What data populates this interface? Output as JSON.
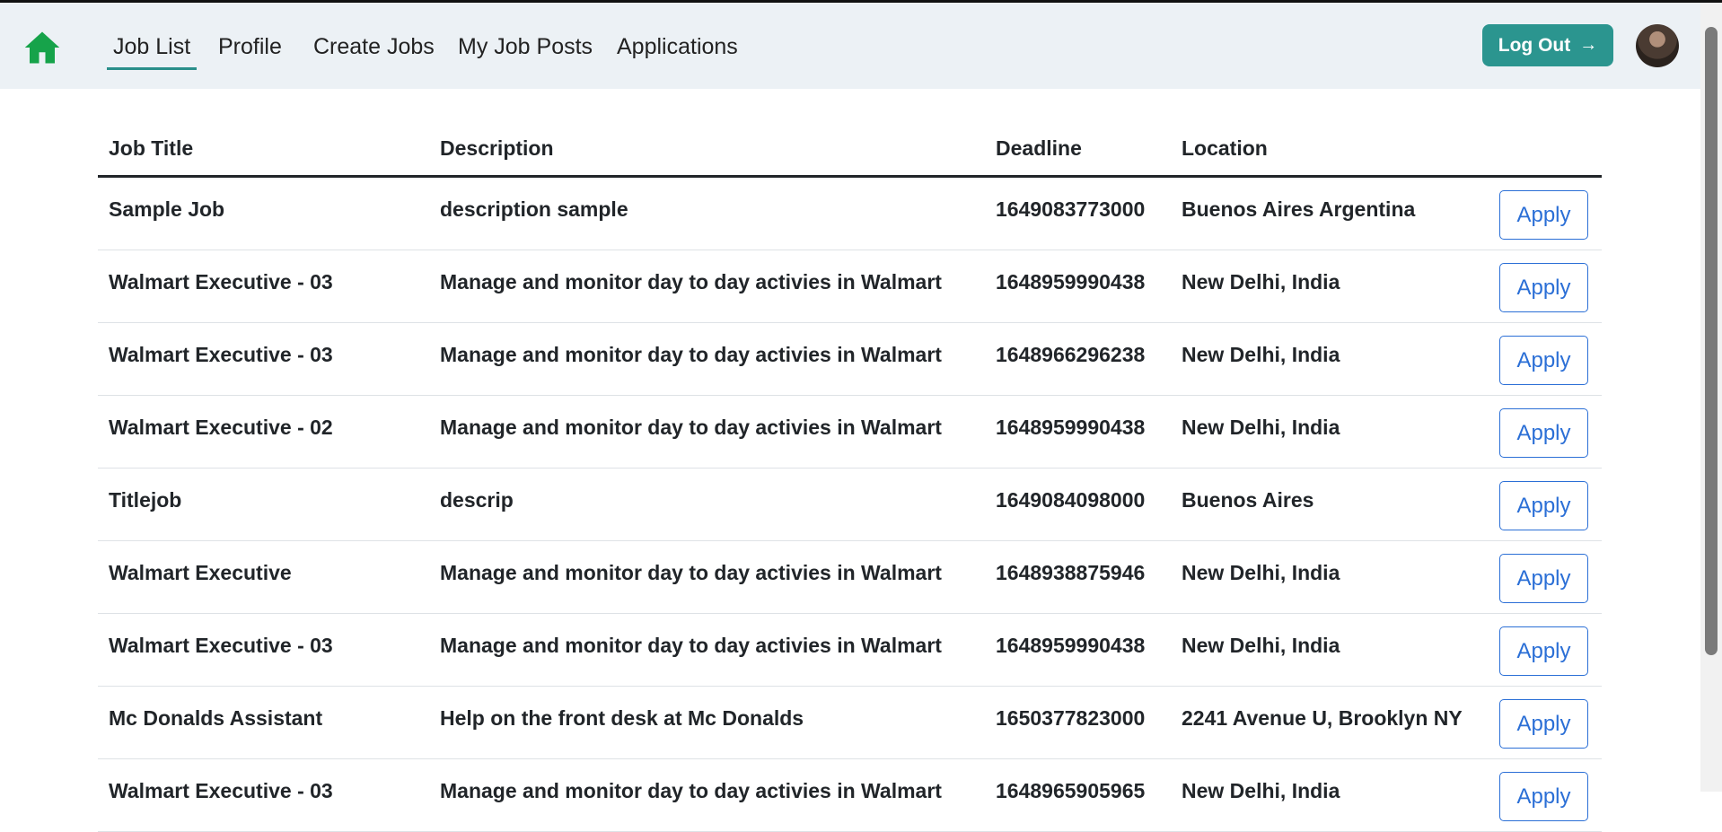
{
  "nav": {
    "items": [
      {
        "label": "Job List",
        "active": true
      },
      {
        "label": "Profile",
        "active": false
      },
      {
        "label": "Create Jobs",
        "active": false
      },
      {
        "label": "My Job Posts",
        "active": false
      },
      {
        "label": "Applications",
        "active": false
      }
    ],
    "logout_label": "Log Out",
    "home_icon": "home-icon",
    "logout_icon": "arrow-right-icon",
    "accent_color": "#2b958f",
    "home_icon_color": "#16a34a"
  },
  "table": {
    "headers": {
      "title": "Job Title",
      "description": "Description",
      "deadline": "Deadline",
      "location": "Location"
    },
    "apply_label": "Apply",
    "rows": [
      {
        "title": "Sample Job",
        "description": "description sample",
        "deadline": "1649083773000",
        "location": "Buenos Aires Argentina"
      },
      {
        "title": "Walmart Executive - 03",
        "description": "Manage and monitor day to day activies in Walmart",
        "deadline": "1648959990438",
        "location": "New Delhi, India"
      },
      {
        "title": "Walmart Executive - 03",
        "description": "Manage and monitor day to day activies in Walmart",
        "deadline": "1648966296238",
        "location": "New Delhi, India"
      },
      {
        "title": "Walmart Executive - 02",
        "description": "Manage and monitor day to day activies in Walmart",
        "deadline": "1648959990438",
        "location": "New Delhi, India"
      },
      {
        "title": "Titlejob",
        "description": "descrip",
        "deadline": "1649084098000",
        "location": "Buenos Aires"
      },
      {
        "title": "Walmart Executive",
        "description": "Manage and monitor day to day activies in Walmart",
        "deadline": "1648938875946",
        "location": "New Delhi, India"
      },
      {
        "title": "Walmart Executive - 03",
        "description": "Manage and monitor day to day activies in Walmart",
        "deadline": "1648959990438",
        "location": "New Delhi, India"
      },
      {
        "title": "Mc Donalds Assistant",
        "description": "Help on the front desk at Mc Donalds",
        "deadline": "1650377823000",
        "location": "2241 Avenue U, Brooklyn NY"
      },
      {
        "title": "Walmart Executive - 03",
        "description": "Manage and monitor day to day activies in Walmart",
        "deadline": "1648965905965",
        "location": "New Delhi, India"
      }
    ]
  }
}
